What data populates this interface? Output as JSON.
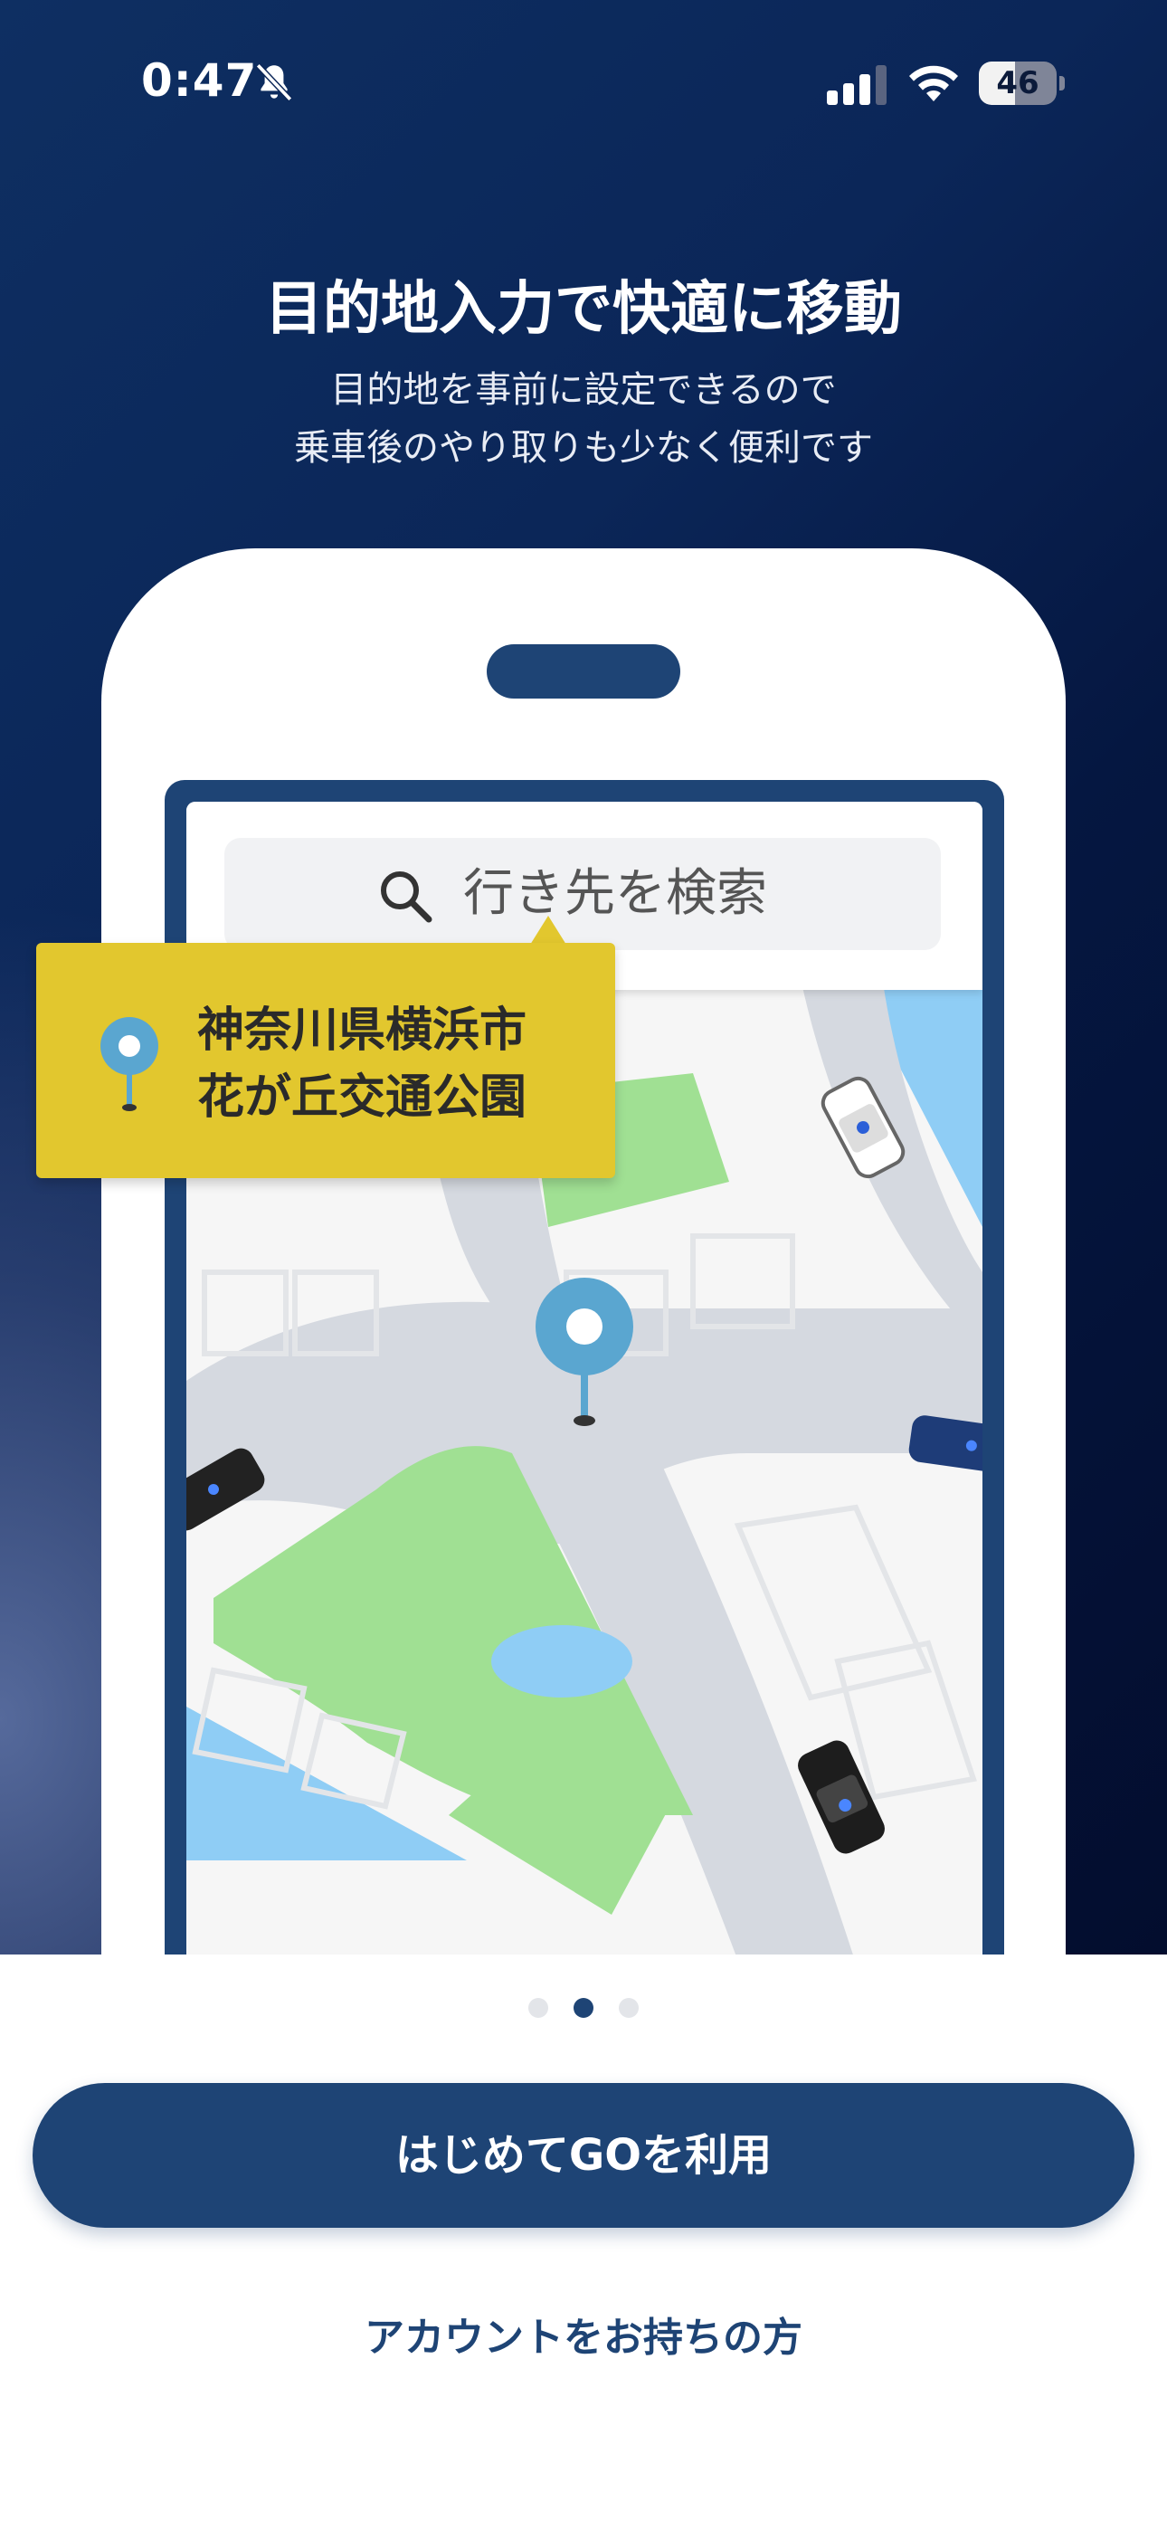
{
  "status_bar": {
    "time": "0:47",
    "battery_level": "46",
    "icons": [
      "bell-slash-icon",
      "cellular-signal-icon",
      "wifi-icon",
      "battery-icon"
    ]
  },
  "intro": {
    "title": "目的地入力で快適に移動",
    "subtitle_line1": "目的地を事前に設定できるので",
    "subtitle_line2": "乗車後のやり取りも少なく便利です"
  },
  "illustration": {
    "search_placeholder": "行き先を検索",
    "destination_line1": "神奈川県横浜市",
    "destination_line2": "花が丘交通公園"
  },
  "pager": {
    "total": 3,
    "active_index": 1
  },
  "actions": {
    "primary_label": "はじめてGOを利用",
    "secondary_label": "アカウントをお持ちの方"
  },
  "colors": {
    "brand_navy": "#1e4475",
    "callout_yellow": "#e2c72e",
    "pin_blue": "#5aa6d0"
  }
}
